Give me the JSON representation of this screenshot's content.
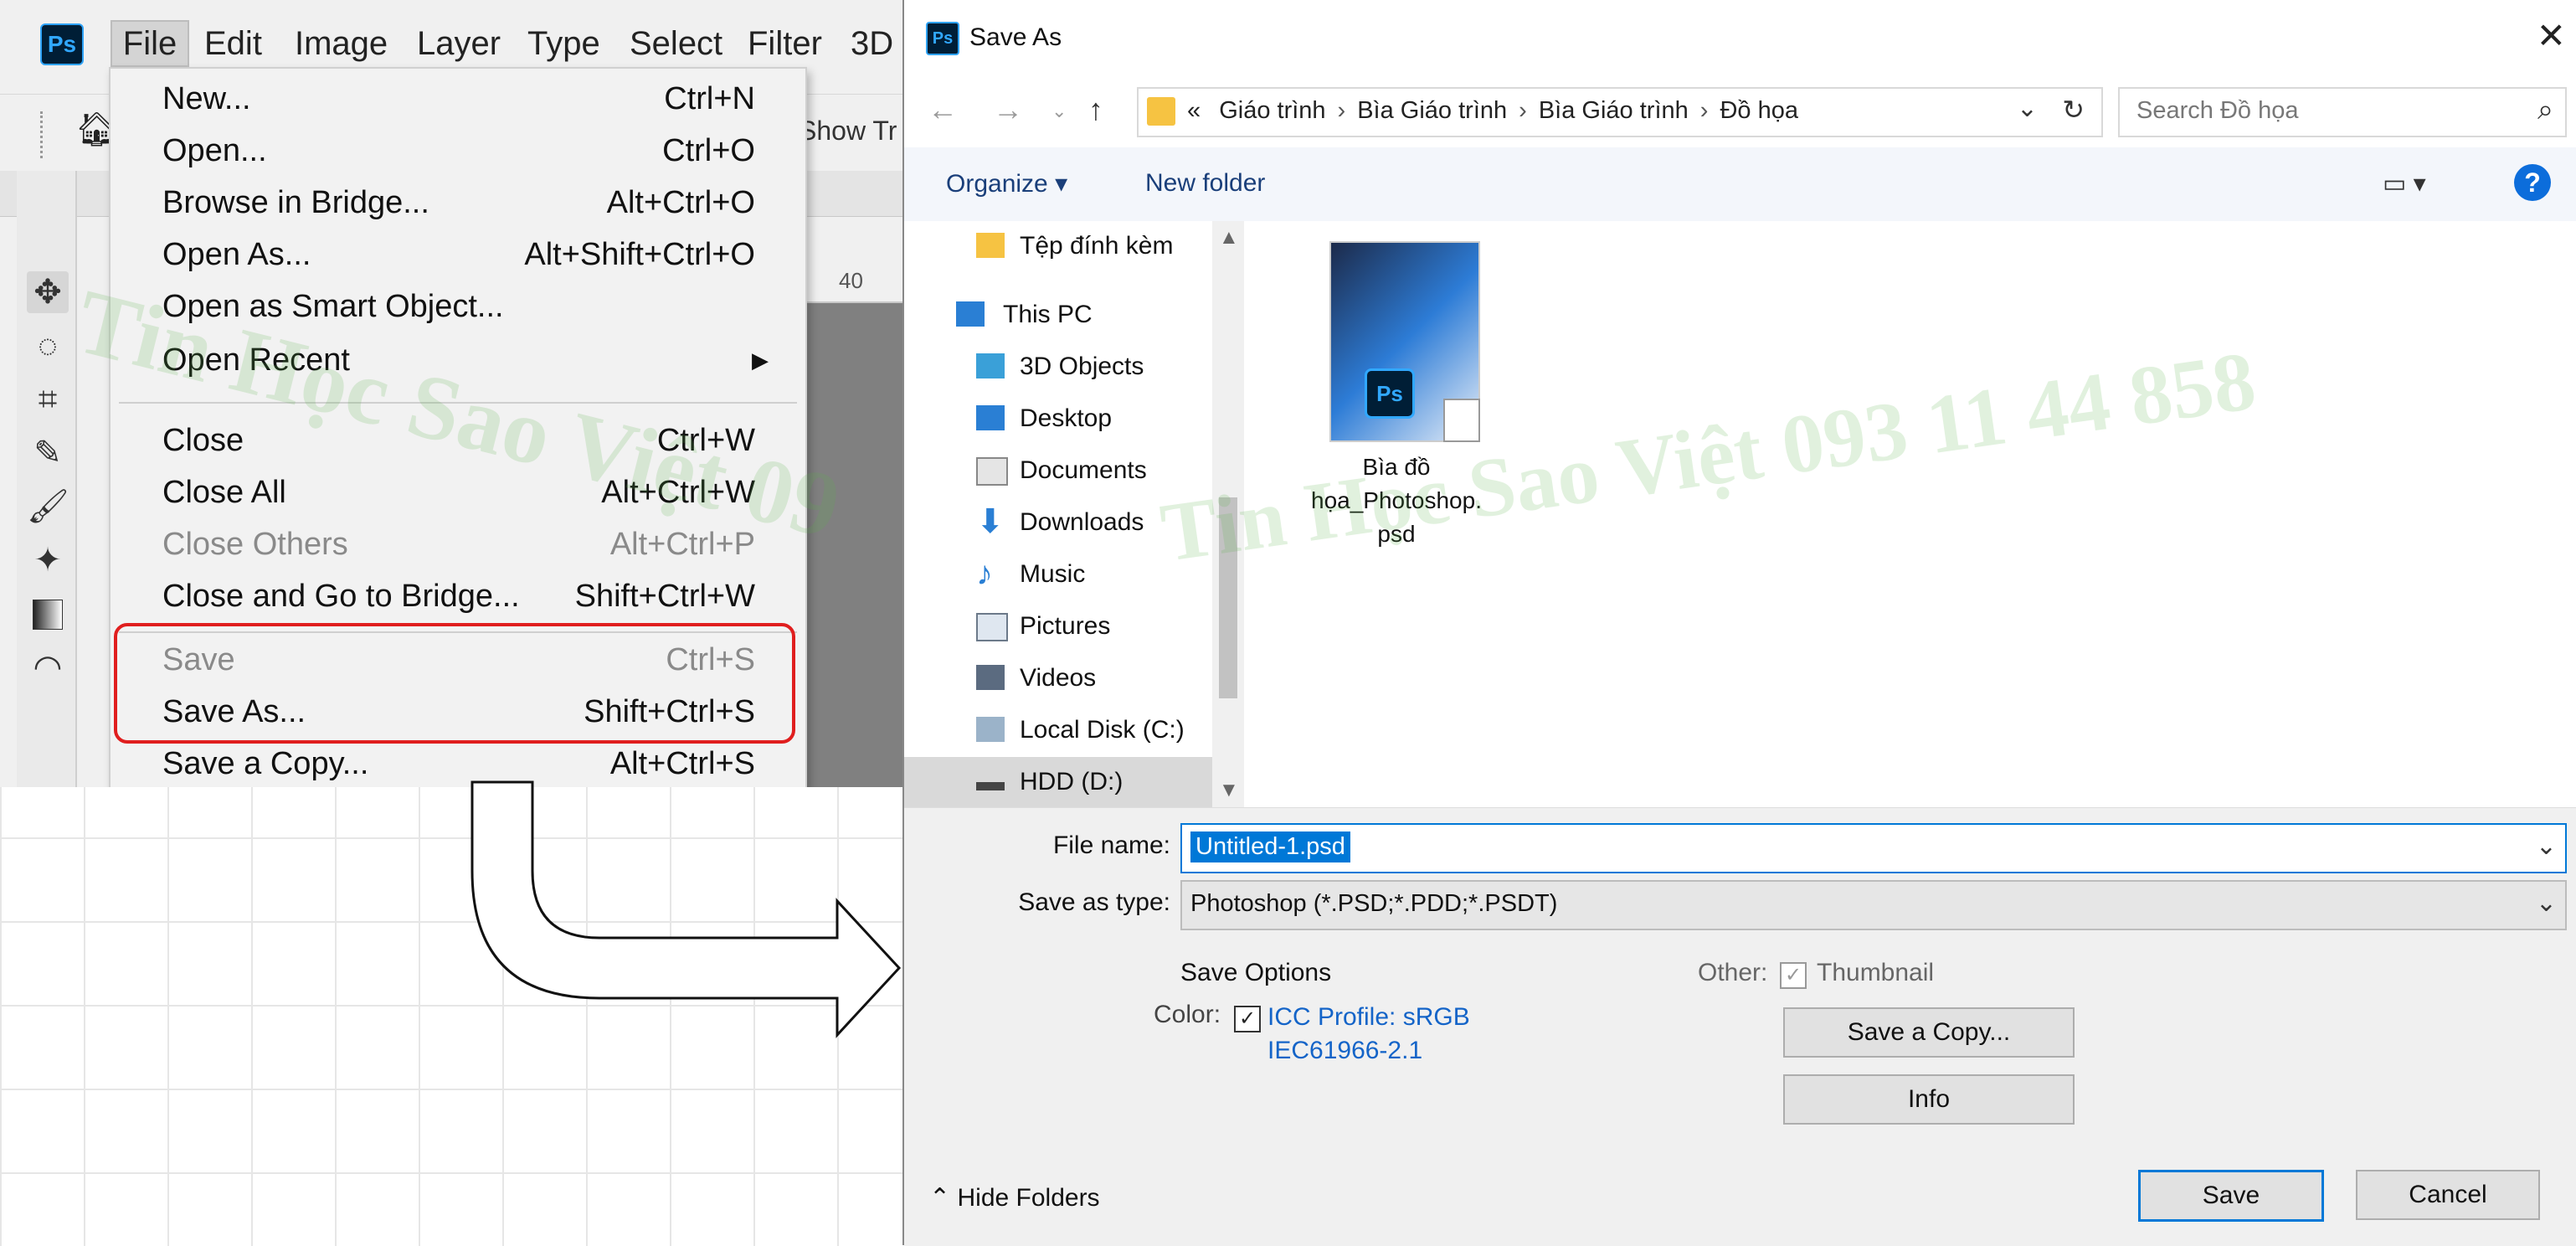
{
  "photoshop": {
    "logo": "Ps",
    "menubar": [
      "File",
      "Edit",
      "Image",
      "Layer",
      "Type",
      "Select",
      "Filter",
      "3D"
    ],
    "options_partial": "Show Tr",
    "ruler_value": "40",
    "collapse_glyph": "‹‹",
    "file_menu": [
      {
        "label": "New...",
        "shortcut": "Ctrl+N"
      },
      {
        "label": "Open...",
        "shortcut": "Ctrl+O"
      },
      {
        "label": "Browse in Bridge...",
        "shortcut": "Alt+Ctrl+O"
      },
      {
        "label": "Open As...",
        "shortcut": "Alt+Shift+Ctrl+O"
      },
      {
        "label": "Open as Smart Object...",
        "shortcut": ""
      },
      {
        "label": "Open Recent",
        "shortcut": ""
      },
      {
        "label": "Close",
        "shortcut": "Ctrl+W"
      },
      {
        "label": "Close All",
        "shortcut": "Alt+Ctrl+W"
      },
      {
        "label": "Close Others",
        "shortcut": "Alt+Ctrl+P"
      },
      {
        "label": "Close and Go to Bridge...",
        "shortcut": "Shift+Ctrl+W"
      },
      {
        "label": "Save",
        "shortcut": "Ctrl+S"
      },
      {
        "label": "Save As...",
        "shortcut": "Shift+Ctrl+S"
      },
      {
        "label": "Save a Copy...",
        "shortcut": "Alt+Ctrl+S"
      }
    ]
  },
  "watermark": {
    "left": "Tin Học Sao Việt 09",
    "right": "Tin Học Sao Việt 093 11 44 858"
  },
  "dialog": {
    "logo": "Ps",
    "title": "Save As",
    "close": "✕",
    "breadcrumb": [
      "«",
      "Giáo trình",
      "Bìa Giáo trình",
      "Bìa Giáo trình",
      "Đồ họa"
    ],
    "search_placeholder": "Search Đồ họa",
    "organize": "Organize ▾",
    "new_folder": "New folder",
    "help": "?",
    "nav_items": [
      "Tệp đính kèm",
      "This PC",
      "3D Objects",
      "Desktop",
      "Documents",
      "Downloads",
      "Music",
      "Pictures",
      "Videos",
      "Local Disk (C:)",
      "HDD (D:)"
    ],
    "file": {
      "name_line1": "Bìa đồ",
      "name_line2": "họa_Photoshop.",
      "name_line3": "psd"
    },
    "file_name_label": "File name:",
    "file_name_value": "Untitled-1.psd",
    "save_type_label": "Save as type:",
    "save_type_value": "Photoshop (*.PSD;*.PDD;*.PSDT)",
    "save_options_title": "Save Options",
    "color_label": "Color:",
    "icc_line1": "ICC Profile:  sRGB",
    "icc_line2": "IEC61966-2.1",
    "other_label": "Other:",
    "thumbnail_label": "Thumbnail",
    "save_copy_btn": "Save a Copy...",
    "info_btn": "Info",
    "hide_folders": "Hide Folders",
    "save_btn": "Save",
    "cancel_btn": "Cancel"
  },
  "colors": {
    "accent": "#0078d7",
    "highlight": "#e01e1e",
    "ps_blue": "#31a8ff"
  }
}
